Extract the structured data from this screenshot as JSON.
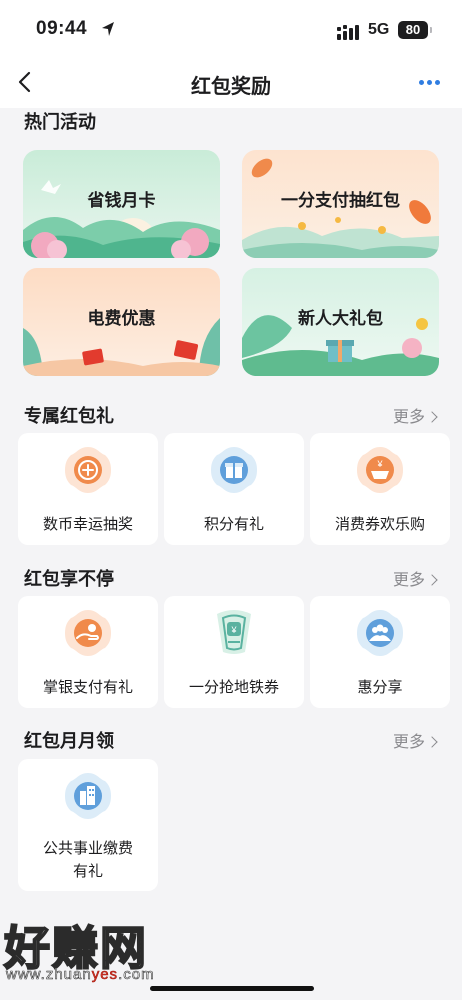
{
  "status_bar": {
    "time": "09:44",
    "network": "5G",
    "battery": "80"
  },
  "nav": {
    "title": "红包奖励"
  },
  "hot": {
    "title": "热门活动",
    "banners": [
      {
        "label": "省钱月卡"
      },
      {
        "label": "一分支付抽红包"
      },
      {
        "label": "电费优惠"
      },
      {
        "label": "新人大礼包"
      }
    ]
  },
  "exclusive": {
    "title": "专属红包礼",
    "more": "更多",
    "items": [
      {
        "label": "数币幸运抽奖",
        "icon": "coin-lottery-icon"
      },
      {
        "label": "积分有礼",
        "icon": "gift-box-icon"
      },
      {
        "label": "消费券欢乐购",
        "icon": "yuan-basket-icon"
      }
    ]
  },
  "nonstop": {
    "title": "红包享不停",
    "more": "更多",
    "items": [
      {
        "label": "掌银支付有礼",
        "icon": "hand-pay-icon"
      },
      {
        "label": "一分抢地铁券",
        "icon": "subway-ticket-icon"
      },
      {
        "label": "惠分享",
        "icon": "people-share-icon"
      }
    ]
  },
  "monthly": {
    "title": "红包月月领",
    "more": "更多",
    "items": [
      {
        "label": "公共事业缴费有礼",
        "icon": "buildings-icon"
      }
    ]
  },
  "watermark": {
    "text": "好赚网",
    "url_prefix": "www.zhuan",
    "url_highlight": "yes",
    "url_suffix": ".com"
  },
  "colors": {
    "accent": "#2f7de1",
    "orange": "#f08a4b",
    "teal": "#5ab2a0",
    "blue_icon": "#5f9fdb"
  }
}
